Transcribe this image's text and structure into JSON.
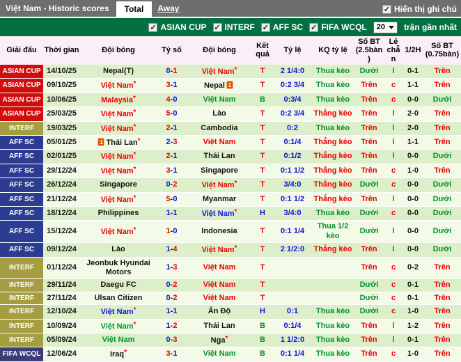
{
  "titlebar": {
    "title": "Việt Nam - Historic scores",
    "tabs": [
      {
        "label": "Total",
        "active": true
      },
      {
        "label": "Away",
        "active": false
      }
    ],
    "note_checkbox": {
      "label": "Hiển thị ghi chú",
      "checked": true
    }
  },
  "filterbar": {
    "competitions": [
      {
        "label": "ASIAN CUP",
        "checked": true
      },
      {
        "label": "INTERF",
        "checked": true
      },
      {
        "label": "AFF SC",
        "checked": true
      },
      {
        "label": "FIFA WCQL",
        "checked": true
      }
    ],
    "match_count_value": "20",
    "match_count_suffix": "trận gần nhất"
  },
  "icons": {
    "check": "✓",
    "red_card_count": "1"
  },
  "colors": {
    "topbar_gray": "#6e6e6e",
    "filterbar_green": "#017040",
    "asian_cup_red": "#d20b0b",
    "interf_olive": "#a49e41",
    "aff_sc_blue": "#2c3d91",
    "fifa_wcql_navy": "#3d3d7a",
    "win_red": "#ee0000",
    "lose_blue": "#1010d8",
    "draw_green": "#009327",
    "stripe_dark": "#ddefca",
    "stripe_light": "#f3fae7",
    "header_pink": "#fbeff7"
  },
  "table": {
    "comp_styles": {
      "ASIAN CUP": "asian",
      "INTERF": "interf",
      "AFF SC": "affsc",
      "FIFA WCQL": "fifawcql"
    },
    "headers": [
      "Giải đấu",
      "Thời gian",
      "Đội bóng",
      "Tỷ số",
      "Đội bóng",
      "Kết quả",
      "Tỷ lệ",
      "KQ tỷ lệ",
      "Số BT (2.5bàn)",
      "Lẻ chẵn",
      "1/2H",
      "Số BT (0.75bàn)"
    ],
    "rows": [
      {
        "comp": "ASIAN CUP",
        "date": "14/10/25",
        "home": {
          "name": "Nepal(T)",
          "color": "black"
        },
        "score": [
          "0",
          "1"
        ],
        "score_colors": [
          "blue",
          "red"
        ],
        "away": {
          "name": "Việt Nam",
          "color": "red",
          "star": true
        },
        "result": [
          "T",
          "red"
        ],
        "odds": "2 1/4:0",
        "odds_result": [
          "Thua kèo",
          "green"
        ],
        "ou25": [
          "Dưới",
          "green"
        ],
        "odd_even": [
          "l",
          "green"
        ],
        "halftime": "0-1",
        "ou075": [
          "Trên",
          "red"
        ]
      },
      {
        "comp": "ASIAN CUP",
        "date": "09/10/25",
        "home": {
          "name": "Việt Nam",
          "color": "red",
          "star": true
        },
        "score": [
          "3",
          "1"
        ],
        "score_colors": [
          "red",
          "blue"
        ],
        "away": {
          "name": "Nepal",
          "color": "black",
          "card": "right"
        },
        "result": [
          "T",
          "red"
        ],
        "odds": "0:2 3/4",
        "odds_result": [
          "Thua kèo",
          "green"
        ],
        "ou25": [
          "Trên",
          "red"
        ],
        "odd_even": [
          "c",
          "red"
        ],
        "halftime": "1-1",
        "ou075": [
          "Trên",
          "red"
        ]
      },
      {
        "comp": "ASIAN CUP",
        "date": "10/06/25",
        "home": {
          "name": "Malaysia",
          "color": "red",
          "star": true
        },
        "score": [
          "4",
          "0"
        ],
        "score_colors": [
          "red",
          "blue"
        ],
        "away": {
          "name": "Việt Nam",
          "color": "green"
        },
        "result": [
          "B",
          "green"
        ],
        "odds": "0:3/4",
        "odds_result": [
          "Thua kèo",
          "green"
        ],
        "ou25": [
          "Trên",
          "red"
        ],
        "odd_even": [
          "c",
          "red"
        ],
        "halftime": "0-0",
        "ou075": [
          "Dưới",
          "green"
        ]
      },
      {
        "comp": "ASIAN CUP",
        "date": "25/03/25",
        "home": {
          "name": "Việt Nam",
          "color": "red",
          "star": true
        },
        "score": [
          "5",
          "0"
        ],
        "score_colors": [
          "red",
          "blue"
        ],
        "away": {
          "name": "Lào",
          "color": "black"
        },
        "result": [
          "T",
          "red"
        ],
        "odds": "0:2 3/4",
        "odds_result": [
          "Thắng kèo",
          "red"
        ],
        "ou25": [
          "Trên",
          "red"
        ],
        "odd_even": [
          "l",
          "green"
        ],
        "halftime": "2-0",
        "ou075": [
          "Trên",
          "red"
        ]
      },
      {
        "comp": "INTERF",
        "date": "19/03/25",
        "home": {
          "name": "Việt Nam",
          "color": "red",
          "star": true
        },
        "score": [
          "2",
          "1"
        ],
        "score_colors": [
          "red",
          "blue"
        ],
        "away": {
          "name": "Cambodia",
          "color": "black"
        },
        "result": [
          "T",
          "red"
        ],
        "odds": "0:2",
        "odds_result": [
          "Thua kèo",
          "green"
        ],
        "ou25": [
          "Trên",
          "red"
        ],
        "odd_even": [
          "l",
          "green"
        ],
        "halftime": "2-0",
        "ou075": [
          "Trên",
          "red"
        ]
      },
      {
        "comp": "AFF SC",
        "date": "05/01/25",
        "home": {
          "name": "Thái Lan",
          "color": "black",
          "star": true,
          "card": "left"
        },
        "score": [
          "2",
          "3"
        ],
        "score_colors": [
          "blue",
          "red"
        ],
        "away": {
          "name": "Việt Nam",
          "color": "red"
        },
        "result": [
          "T",
          "red"
        ],
        "odds": "0:1/4",
        "odds_result": [
          "Thắng kèo",
          "red"
        ],
        "ou25": [
          "Trên",
          "red"
        ],
        "odd_even": [
          "l",
          "green"
        ],
        "halftime": "1-1",
        "ou075": [
          "Trên",
          "red"
        ]
      },
      {
        "comp": "AFF SC",
        "date": "02/01/25",
        "home": {
          "name": "Việt Nam",
          "color": "red",
          "star": true
        },
        "score": [
          "2",
          "1"
        ],
        "score_colors": [
          "red",
          "blue"
        ],
        "away": {
          "name": "Thái Lan",
          "color": "black"
        },
        "result": [
          "T",
          "red"
        ],
        "odds": "0:1/2",
        "odds_result": [
          "Thắng kèo",
          "red"
        ],
        "ou25": [
          "Trên",
          "red"
        ],
        "odd_even": [
          "l",
          "green"
        ],
        "halftime": "0-0",
        "ou075": [
          "Dưới",
          "green"
        ]
      },
      {
        "comp": "AFF SC",
        "date": "29/12/24",
        "home": {
          "name": "Việt Nam",
          "color": "red",
          "star": true
        },
        "score": [
          "3",
          "1"
        ],
        "score_colors": [
          "red",
          "blue"
        ],
        "away": {
          "name": "Singapore",
          "color": "black"
        },
        "result": [
          "T",
          "red"
        ],
        "odds": "0:1 1/2",
        "odds_result": [
          "Thắng kèo",
          "red"
        ],
        "ou25": [
          "Trên",
          "red"
        ],
        "odd_even": [
          "c",
          "red"
        ],
        "halftime": "1-0",
        "ou075": [
          "Trên",
          "red"
        ]
      },
      {
        "comp": "AFF SC",
        "date": "26/12/24",
        "home": {
          "name": "Singapore",
          "color": "black"
        },
        "score": [
          "0",
          "2"
        ],
        "score_colors": [
          "blue",
          "red"
        ],
        "away": {
          "name": "Việt Nam",
          "color": "red",
          "star": true
        },
        "result": [
          "T",
          "red"
        ],
        "odds": "3/4:0",
        "odds_result": [
          "Thắng kèo",
          "red"
        ],
        "ou25": [
          "Dưới",
          "green"
        ],
        "odd_even": [
          "c",
          "red"
        ],
        "halftime": "0-0",
        "ou075": [
          "Dưới",
          "green"
        ]
      },
      {
        "comp": "AFF SC",
        "date": "21/12/24",
        "home": {
          "name": "Việt Nam",
          "color": "red",
          "star": true
        },
        "score": [
          "5",
          "0"
        ],
        "score_colors": [
          "red",
          "blue"
        ],
        "away": {
          "name": "Myanmar",
          "color": "black"
        },
        "result": [
          "T",
          "red"
        ],
        "odds": "0:1 1/2",
        "odds_result": [
          "Thắng kèo",
          "red"
        ],
        "ou25": [
          "Trên",
          "red"
        ],
        "odd_even": [
          "l",
          "green"
        ],
        "halftime": "0-0",
        "ou075": [
          "Dưới",
          "green"
        ]
      },
      {
        "comp": "AFF SC",
        "date": "18/12/24",
        "home": {
          "name": "Philippines",
          "color": "black"
        },
        "score": [
          "1",
          "1"
        ],
        "score_colors": [
          "blue",
          "blue"
        ],
        "away": {
          "name": "Việt Nam",
          "color": "blue",
          "star": true
        },
        "result": [
          "H",
          "blue"
        ],
        "odds": "3/4:0",
        "odds_result": [
          "Thua kèo",
          "green"
        ],
        "ou25": [
          "Dưới",
          "green"
        ],
        "odd_even": [
          "c",
          "red"
        ],
        "halftime": "0-0",
        "ou075": [
          "Dưới",
          "green"
        ]
      },
      {
        "comp": "AFF SC",
        "date": "15/12/24",
        "home": {
          "name": "Việt Nam",
          "color": "red",
          "star": true
        },
        "score": [
          "1",
          "0"
        ],
        "score_colors": [
          "red",
          "blue"
        ],
        "away": {
          "name": "Indonesia",
          "color": "black"
        },
        "result": [
          "T",
          "red"
        ],
        "odds": "0:1 1/4",
        "odds_result": [
          "Thua 1/2 kèo",
          "green"
        ],
        "ou25": [
          "Dưới",
          "green"
        ],
        "odd_even": [
          "l",
          "green"
        ],
        "halftime": "0-0",
        "ou075": [
          "Dưới",
          "green"
        ]
      },
      {
        "comp": "AFF SC",
        "date": "09/12/24",
        "home": {
          "name": "Lào",
          "color": "black"
        },
        "score": [
          "1",
          "4"
        ],
        "score_colors": [
          "blue",
          "red"
        ],
        "away": {
          "name": "Việt Nam",
          "color": "red",
          "star": true
        },
        "result": [
          "T",
          "red"
        ],
        "odds": "2 1/2:0",
        "odds_result": [
          "Thắng kèo",
          "red"
        ],
        "ou25": [
          "Trên",
          "red"
        ],
        "odd_even": [
          "l",
          "green"
        ],
        "halftime": "0-0",
        "ou075": [
          "Dưới",
          "green"
        ]
      },
      {
        "comp": "INTERF",
        "date": "01/12/24",
        "home": {
          "name": "Jeonbuk Hyundai Motors",
          "color": "black"
        },
        "score": [
          "1",
          "3"
        ],
        "score_colors": [
          "blue",
          "red"
        ],
        "away": {
          "name": "Việt Nam",
          "color": "red"
        },
        "result": [
          "T",
          "red"
        ],
        "odds": "",
        "odds_result": [
          "",
          ""
        ],
        "ou25": [
          "Trên",
          "red"
        ],
        "odd_even": [
          "c",
          "red"
        ],
        "halftime": "0-2",
        "ou075": [
          "Trên",
          "red"
        ]
      },
      {
        "comp": "INTERF",
        "date": "29/11/24",
        "home": {
          "name": "Daegu FC",
          "color": "black"
        },
        "score": [
          "0",
          "2"
        ],
        "score_colors": [
          "blue",
          "red"
        ],
        "away": {
          "name": "Việt Nam",
          "color": "red"
        },
        "result": [
          "T",
          "red"
        ],
        "odds": "",
        "odds_result": [
          "",
          ""
        ],
        "ou25": [
          "Dưới",
          "green"
        ],
        "odd_even": [
          "c",
          "red"
        ],
        "halftime": "0-1",
        "ou075": [
          "Trên",
          "red"
        ]
      },
      {
        "comp": "INTERF",
        "date": "27/11/24",
        "home": {
          "name": "Ulsan Citizen",
          "color": "black"
        },
        "score": [
          "0",
          "2"
        ],
        "score_colors": [
          "blue",
          "red"
        ],
        "away": {
          "name": "Việt Nam",
          "color": "red"
        },
        "result": [
          "T",
          "red"
        ],
        "odds": "",
        "odds_result": [
          "",
          ""
        ],
        "ou25": [
          "Dưới",
          "green"
        ],
        "odd_even": [
          "c",
          "red"
        ],
        "halftime": "0-1",
        "ou075": [
          "Trên",
          "red"
        ]
      },
      {
        "comp": "INTERF",
        "date": "12/10/24",
        "home": {
          "name": "Việt Nam",
          "color": "blue",
          "star": true
        },
        "score": [
          "1",
          "1"
        ],
        "score_colors": [
          "blue",
          "blue"
        ],
        "away": {
          "name": "Ấn Độ",
          "color": "black"
        },
        "result": [
          "H",
          "blue"
        ],
        "odds": "0:1",
        "odds_result": [
          "Thua kèo",
          "green"
        ],
        "ou25": [
          "Dưới",
          "green"
        ],
        "odd_even": [
          "c",
          "red"
        ],
        "halftime": "1-0",
        "ou075": [
          "Trên",
          "red"
        ]
      },
      {
        "comp": "INTERF",
        "date": "10/09/24",
        "home": {
          "name": "Việt Nam",
          "color": "green",
          "star": true
        },
        "score": [
          "1",
          "2"
        ],
        "score_colors": [
          "blue",
          "red"
        ],
        "away": {
          "name": "Thái Lan",
          "color": "black"
        },
        "result": [
          "B",
          "green"
        ],
        "odds": "0:1/4",
        "odds_result": [
          "Thua kèo",
          "green"
        ],
        "ou25": [
          "Trên",
          "red"
        ],
        "odd_even": [
          "l",
          "green"
        ],
        "halftime": "1-2",
        "ou075": [
          "Trên",
          "red"
        ]
      },
      {
        "comp": "INTERF",
        "date": "05/09/24",
        "home": {
          "name": "Việt Nam",
          "color": "green"
        },
        "score": [
          "0",
          "3"
        ],
        "score_colors": [
          "blue",
          "red"
        ],
        "away": {
          "name": "Nga",
          "color": "black",
          "star": true
        },
        "result": [
          "B",
          "green"
        ],
        "odds": "1 1/2:0",
        "odds_result": [
          "Thua kèo",
          "green"
        ],
        "ou25": [
          "Trên",
          "red"
        ],
        "odd_even": [
          "l",
          "green"
        ],
        "halftime": "0-1",
        "ou075": [
          "Trên",
          "red"
        ]
      },
      {
        "comp": "FIFA WCQL",
        "date": "12/06/24",
        "home": {
          "name": "Iraq",
          "color": "black",
          "star": true
        },
        "score": [
          "3",
          "1"
        ],
        "score_colors": [
          "red",
          "blue"
        ],
        "away": {
          "name": "Việt Nam",
          "color": "green"
        },
        "result": [
          "B",
          "green"
        ],
        "odds": "0:1 1/4",
        "odds_result": [
          "Thua kèo",
          "green"
        ],
        "ou25": [
          "Trên",
          "red"
        ],
        "odd_even": [
          "c",
          "red"
        ],
        "halftime": "1-0",
        "ou075": [
          "Trên",
          "red"
        ]
      }
    ]
  }
}
